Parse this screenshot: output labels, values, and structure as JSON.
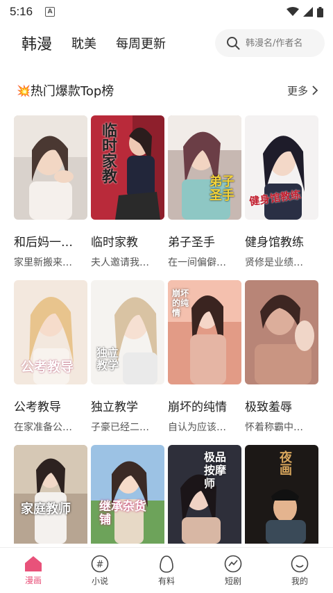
{
  "status": {
    "time": "5:16",
    "badge": "A"
  },
  "header": {
    "tabs": [
      {
        "label": "韩漫",
        "active": true
      },
      {
        "label": "耽美",
        "active": false
      },
      {
        "label": "每周更新",
        "active": false
      }
    ],
    "search_placeholder": "韩漫名/作者名"
  },
  "section": {
    "icon": "💥",
    "title": "热门爆款Top榜",
    "more": "更多"
  },
  "comics": [
    {
      "title": "和后妈一…",
      "desc": "家里新搬来…",
      "cover_text": ""
    },
    {
      "title": "临时家教",
      "desc": "夫人邀请我…",
      "cover_text": "临时家教"
    },
    {
      "title": "弟子圣手",
      "desc": "在一间偏僻…",
      "cover_text": "弟子圣手"
    },
    {
      "title": "健身馆教练",
      "desc": "贤修是业绩…",
      "cover_text": "健身馆教练"
    },
    {
      "title": "公考教导",
      "desc": "在家准备公…",
      "cover_text": "公考教导"
    },
    {
      "title": "独立教学",
      "desc": "子豪已经二…",
      "cover_text": "独立教学"
    },
    {
      "title": "崩坏的纯情",
      "desc": "自认为应该…",
      "cover_text": "崩坏的纯情"
    },
    {
      "title": "极致羞辱",
      "desc": "怀着称霸中…",
      "cover_text": ""
    },
    {
      "title": "",
      "desc": "",
      "cover_text": "家庭教师"
    },
    {
      "title": "",
      "desc": "",
      "cover_text": "继承杂货铺"
    },
    {
      "title": "",
      "desc": "",
      "cover_text": "极品按摩师"
    },
    {
      "title": "",
      "desc": "",
      "cover_text": "夜画"
    }
  ],
  "tabbar": [
    {
      "label": "漫画",
      "icon": "house-icon",
      "active": true
    },
    {
      "label": "小说",
      "icon": "hash-icon",
      "active": false
    },
    {
      "label": "有料",
      "icon": "egg-icon",
      "active": false
    },
    {
      "label": "短剧",
      "icon": "pulse-icon",
      "active": false
    },
    {
      "label": "我的",
      "icon": "smile-icon",
      "active": false
    }
  ],
  "colors": {
    "accent": "#e8527a"
  }
}
